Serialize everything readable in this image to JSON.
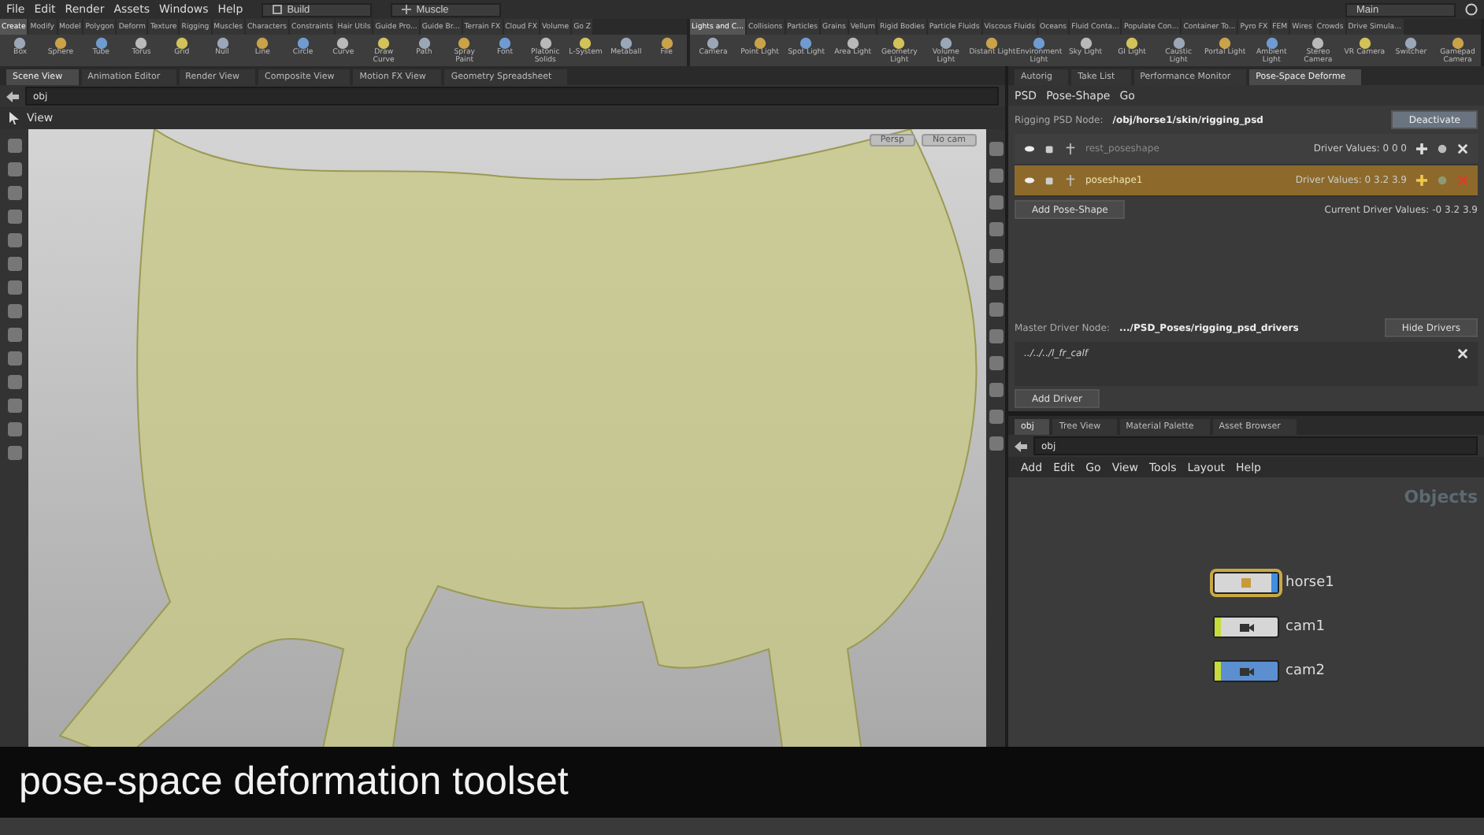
{
  "menu_bar": {
    "items": [
      "File",
      "Edit",
      "Render",
      "Assets",
      "Windows",
      "Help"
    ],
    "desktops": [
      {
        "label": "Build",
        "kind": "desk"
      },
      {
        "label": "Muscle",
        "kind": "rig"
      }
    ],
    "main_desktop": "Main"
  },
  "shelf": {
    "left_tabs": [
      {
        "label": "Create",
        "selected": true
      },
      {
        "label": "Modify",
        "selected": false
      },
      {
        "label": "Model",
        "selected": false
      },
      {
        "label": "Polygon",
        "selected": false
      },
      {
        "label": "Deform",
        "selected": false
      },
      {
        "label": "Texture",
        "selected": false
      },
      {
        "label": "Rigging",
        "selected": false
      },
      {
        "label": "Muscles",
        "selected": false
      },
      {
        "label": "Characters",
        "selected": false
      },
      {
        "label": "Constraints",
        "selected": false
      },
      {
        "label": "Hair Utils",
        "selected": false
      },
      {
        "label": "Guide Pro...",
        "selected": false
      },
      {
        "label": "Guide Br...",
        "selected": false
      },
      {
        "label": "Terrain FX",
        "selected": false
      },
      {
        "label": "Cloud FX",
        "selected": false
      },
      {
        "label": "Volume",
        "selected": false
      },
      {
        "label": "Go Z",
        "selected": false
      }
    ],
    "left_tools": [
      "Box",
      "Sphere",
      "Tube",
      "Torus",
      "Grid",
      "Null",
      "Line",
      "Circle",
      "Curve",
      "Draw Curve",
      "Path",
      "Spray Paint",
      "Font",
      "Platonic Solids",
      "L-System",
      "Metaball",
      "File"
    ],
    "right_tabs": [
      {
        "label": "Lights and C...",
        "selected": true
      },
      {
        "label": "Collisions",
        "selected": false
      },
      {
        "label": "Particles",
        "selected": false
      },
      {
        "label": "Grains",
        "selected": false
      },
      {
        "label": "Vellum",
        "selected": false
      },
      {
        "label": "Rigid Bodies",
        "selected": false
      },
      {
        "label": "Particle Fluids",
        "selected": false
      },
      {
        "label": "Viscous Fluids",
        "selected": false
      },
      {
        "label": "Oceans",
        "selected": false
      },
      {
        "label": "Fluid Conta...",
        "selected": false
      },
      {
        "label": "Populate Con...",
        "selected": false
      },
      {
        "label": "Container To...",
        "selected": false
      },
      {
        "label": "Pyro FX",
        "selected": false
      },
      {
        "label": "FEM",
        "selected": false
      },
      {
        "label": "Wires",
        "selected": false
      },
      {
        "label": "Crowds",
        "selected": false
      },
      {
        "label": "Drive Simula...",
        "selected": false
      }
    ],
    "right_tools": [
      "Camera",
      "Point Light",
      "Spot Light",
      "Area Light",
      "Geometry Light",
      "Volume Light",
      "Distant Light",
      "Environment Light",
      "Sky Light",
      "GI Light",
      "Caustic Light",
      "Portal Light",
      "Ambient Light",
      "Stereo Camera",
      "VR Camera",
      "Switcher",
      "Gamepad Camera"
    ]
  },
  "scene_pane": {
    "tabs": [
      {
        "label": "Scene View",
        "selected": true
      },
      {
        "label": "Animation Editor",
        "selected": false
      },
      {
        "label": "Render View",
        "selected": false
      },
      {
        "label": "Composite View",
        "selected": false
      },
      {
        "label": "Motion FX View",
        "selected": false
      },
      {
        "label": "Geometry Spreadsheet",
        "selected": false
      }
    ],
    "path": "obj",
    "toolbar_label": "View",
    "view_menus": [
      "Persp",
      "No cam"
    ]
  },
  "psd_pane": {
    "tabs": [
      {
        "label": "Autorig",
        "selected": false
      },
      {
        "label": "Take List",
        "selected": false
      },
      {
        "label": "Performance Monitor",
        "selected": false
      },
      {
        "label": "Pose-Space Deforme",
        "selected": true
      }
    ],
    "menu": [
      "PSD",
      "Pose-Shape",
      "Go"
    ],
    "rigging_label": "Rigging PSD Node:",
    "rigging_path": "/obj/horse1/skin/rigging_psd",
    "deactivate": "Deactivate",
    "pose_shapes": [
      {
        "name": "rest_poseshape",
        "driver_values": "Driver Values: 0 0 0",
        "selected": false
      },
      {
        "name": "poseshape1",
        "driver_values": "Driver Values: 0 3.2 3.9",
        "selected": true
      }
    ],
    "add_pose_shape": "Add Pose-Shape",
    "current_driver_values": "Current Driver Values: -0 3.2 3.9",
    "master_label": "Master Driver Node:",
    "master_path": ".../PSD_Poses/rigging_psd_drivers",
    "hide_drivers": "Hide Drivers",
    "drivers": [
      "../../../l_fr_calf"
    ],
    "add_driver": "Add Driver"
  },
  "network_pane": {
    "tabs": [
      {
        "label": "obj",
        "selected": true
      },
      {
        "label": "Tree View",
        "selected": false
      },
      {
        "label": "Material Palette",
        "selected": false
      },
      {
        "label": "Asset Browser",
        "selected": false
      }
    ],
    "path": "obj",
    "menu": [
      "Add",
      "Edit",
      "Go",
      "View",
      "Tools",
      "Layout",
      "Help"
    ],
    "context_label": "Objects",
    "nodes": [
      {
        "name": "horse1",
        "kind": "geometry",
        "selected": true,
        "color": "#d6d6d6"
      },
      {
        "name": "cam1",
        "kind": "camera",
        "selected": false,
        "color": "#d6d6d6"
      },
      {
        "name": "cam2",
        "kind": "camera",
        "selected": false,
        "color": "#5b8fd0"
      }
    ]
  },
  "caption": "pose-space deformation toolset"
}
